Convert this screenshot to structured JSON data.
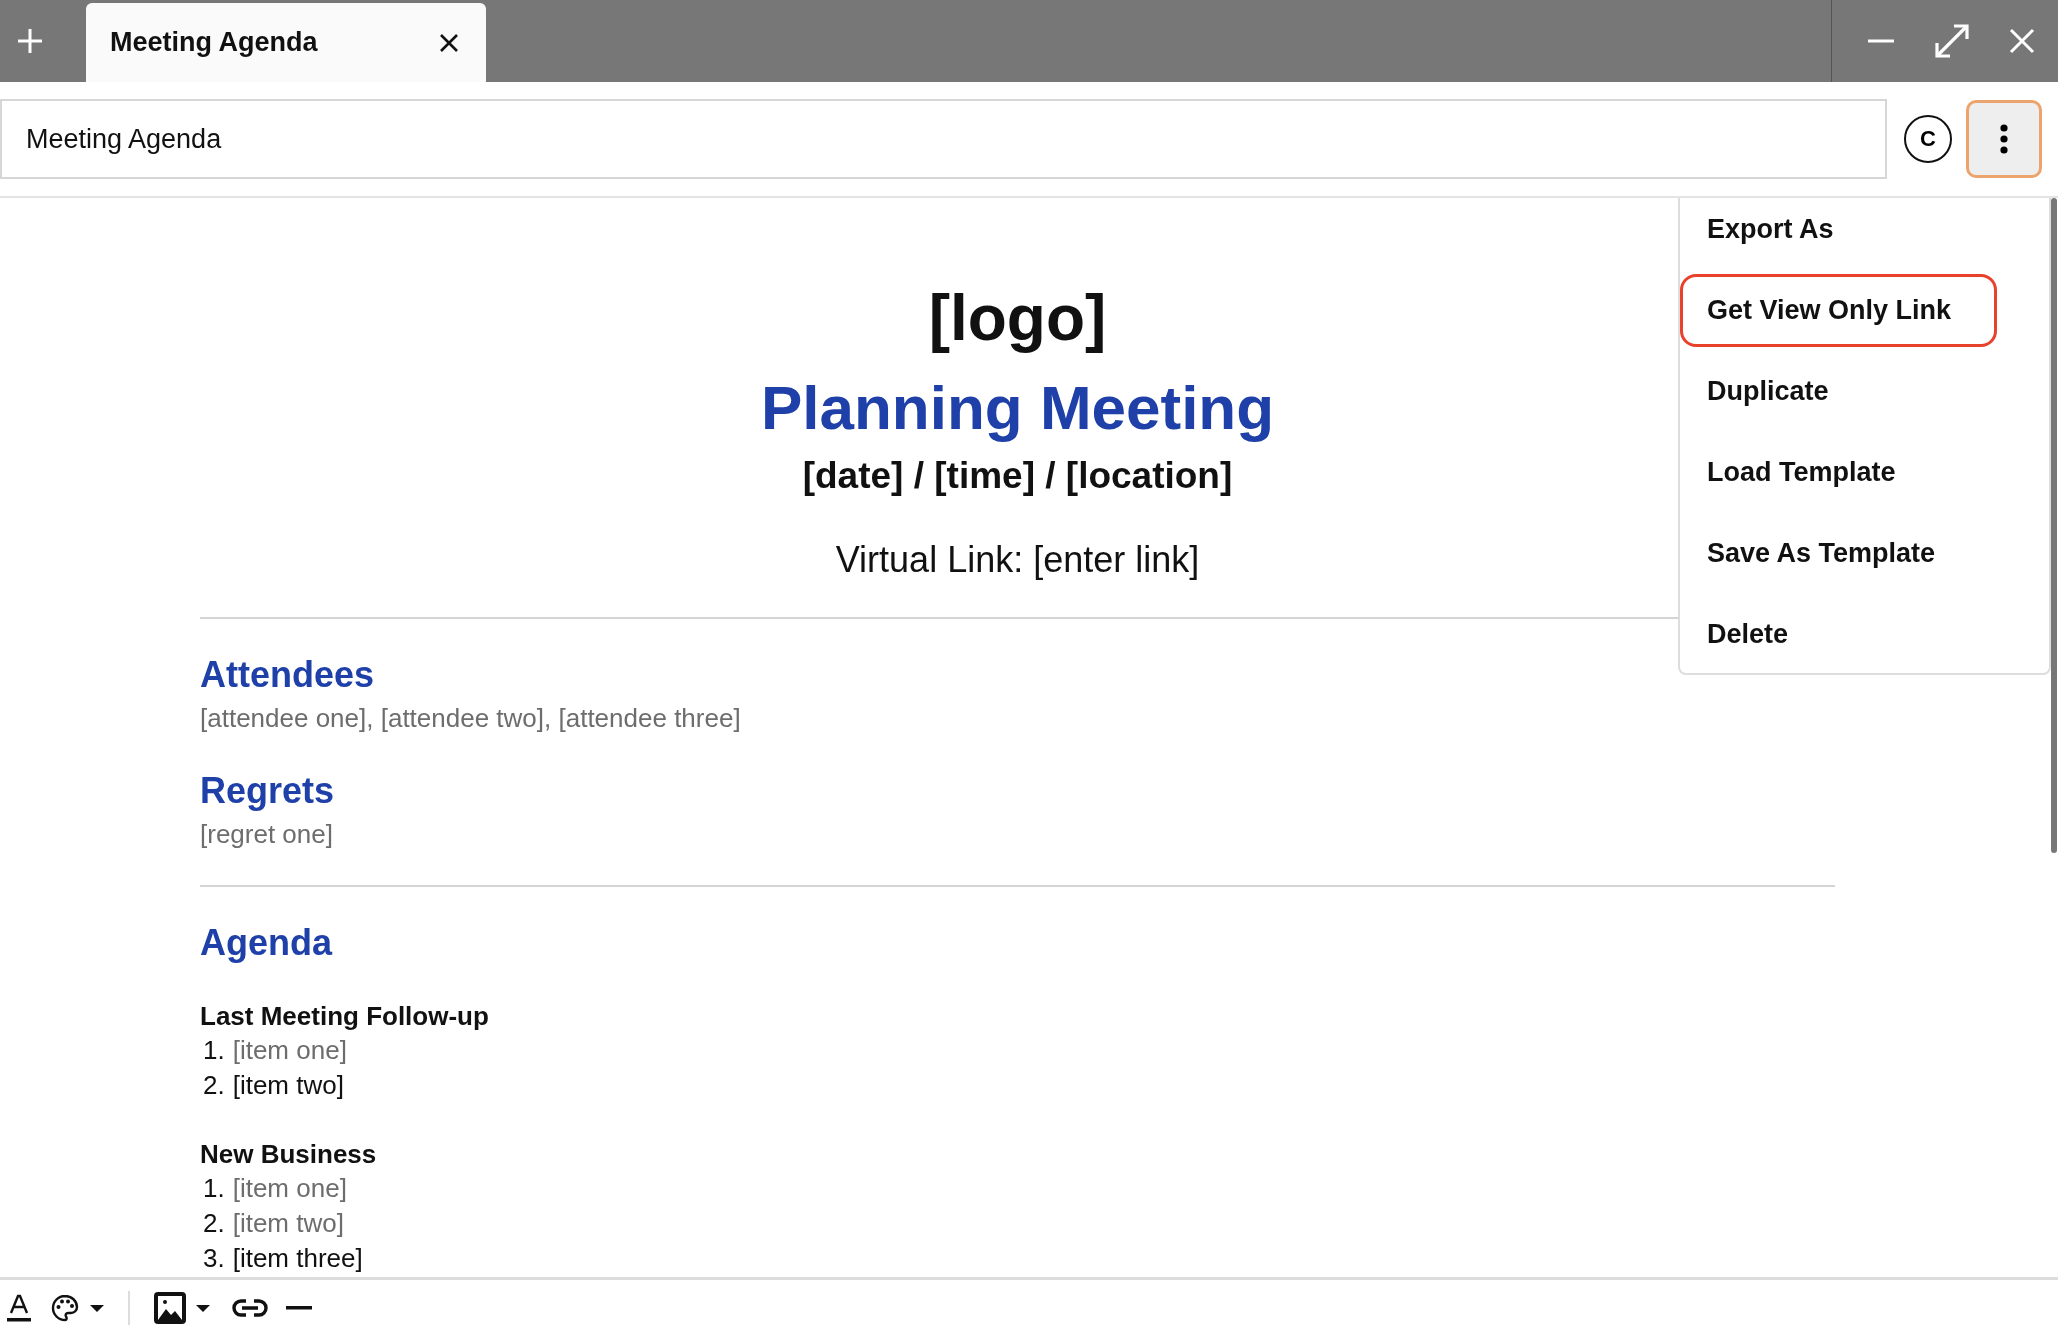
{
  "tabs": [
    {
      "label": "Meeting Agenda",
      "selected": true
    }
  ],
  "title_field": {
    "value": "Meeting Agenda"
  },
  "avatar": {
    "initial": "C"
  },
  "more_button": {
    "focused": true
  },
  "menu": {
    "items": [
      {
        "label": "Export As",
        "highlighted": false
      },
      {
        "label": "Get View Only Link",
        "highlighted": true
      },
      {
        "label": "Duplicate",
        "highlighted": false
      },
      {
        "label": "Load Template",
        "highlighted": false
      },
      {
        "label": "Save As Template",
        "highlighted": false
      },
      {
        "label": "Delete",
        "highlighted": false
      }
    ]
  },
  "document": {
    "logo": "[logo]",
    "title": "Planning Meeting",
    "subtitle": "[date] / [time] / [location]",
    "virtual_link": "Virtual Link: [enter link]",
    "blocks": [
      {
        "kind": "divider"
      },
      {
        "kind": "heading",
        "text": "Attendees"
      },
      {
        "kind": "text",
        "text": "[attendee one], [attendee two], [attendee three]",
        "muted": true
      },
      {
        "kind": "heading",
        "text": "Regrets"
      },
      {
        "kind": "text",
        "text": "[regret one]",
        "muted": true
      },
      {
        "kind": "divider"
      },
      {
        "kind": "heading",
        "text": "Agenda"
      },
      {
        "kind": "subheading",
        "text": "Last Meeting Follow-up"
      },
      {
        "kind": "item",
        "number": "1.",
        "text": "[item one]",
        "muted": true
      },
      {
        "kind": "item",
        "number": "2.",
        "text": "[item two]",
        "muted": false
      },
      {
        "kind": "subheading",
        "text": "New Business"
      },
      {
        "kind": "item",
        "number": "1.",
        "text": "[item one]",
        "muted": true
      },
      {
        "kind": "item",
        "number": "2.",
        "text": "[item two]",
        "muted": true
      },
      {
        "kind": "item",
        "number": "3.",
        "text": "[item three]",
        "muted": false
      }
    ]
  }
}
